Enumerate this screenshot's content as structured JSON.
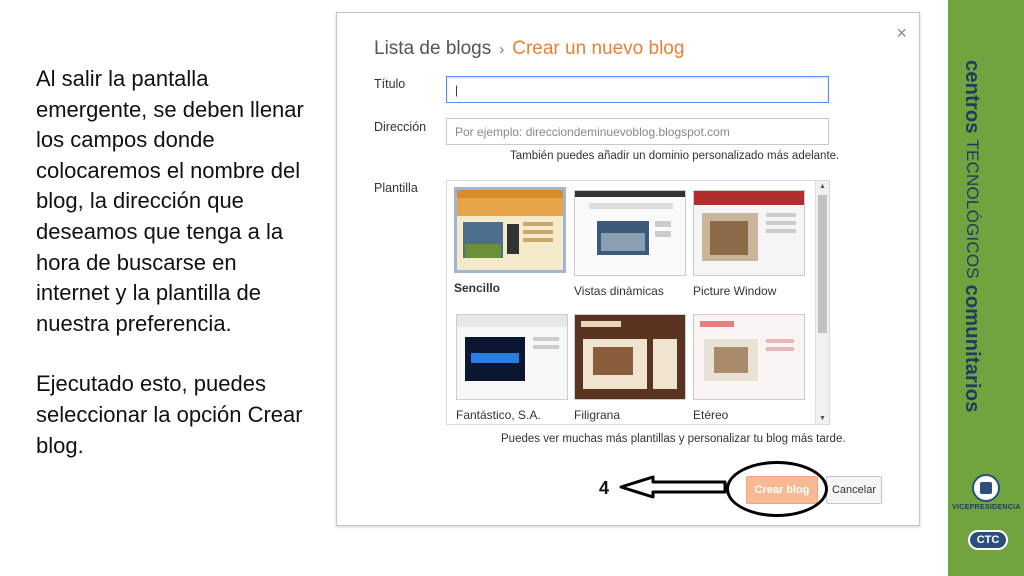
{
  "explanation": {
    "paragraph1": "Al salir la pantalla emergente, se deben llenar los campos donde colocaremos el nombre del blog, la dirección que deseamos que tenga a la hora de buscarse en internet y la plantilla de nuestra preferencia.",
    "paragraph2": "Ejecutado esto, puedes seleccionar la opción Crear blog."
  },
  "dialog": {
    "breadcrumb_parent": "Lista de blogs",
    "breadcrumb_sep": "›",
    "breadcrumb_current": "Crear un nuevo blog",
    "close_glyph": "×",
    "title_label": "Título",
    "title_value": "|",
    "address_label": "Dirección",
    "address_placeholder": "Por ejemplo: direcciondeminuevoblog.blogspot.com",
    "address_hint": "También puedes añadir un dominio personalizado más adelante.",
    "template_label": "Plantilla",
    "templates": [
      {
        "name": "Sencillo",
        "selected": true
      },
      {
        "name": "Vistas dinámicas",
        "selected": false
      },
      {
        "name": "Picture Window",
        "selected": false
      },
      {
        "name": "Fantástico, S.A.",
        "selected": false
      },
      {
        "name": "Filigrana",
        "selected": false
      },
      {
        "name": "Etéreo",
        "selected": false
      }
    ],
    "more_templates_hint": "Puedes ver muchas más plantillas y personalizar tu blog más tarde.",
    "create_button": "Crear blog",
    "cancel_button": "Cancelar"
  },
  "annotation": {
    "step_number": "4"
  },
  "brand": {
    "word1": "centros",
    "word2": "TECNOLÓGICOS",
    "word3": "comunitarios",
    "vice": "VICEPRESIDENCIA",
    "ctc": "CTC"
  },
  "colors": {
    "accent_orange": "#e8813a",
    "brand_green": "#71a33f",
    "brand_navy": "#223a5e",
    "focus_blue": "#4d90fe",
    "create_button_bg": "#f8b995"
  }
}
